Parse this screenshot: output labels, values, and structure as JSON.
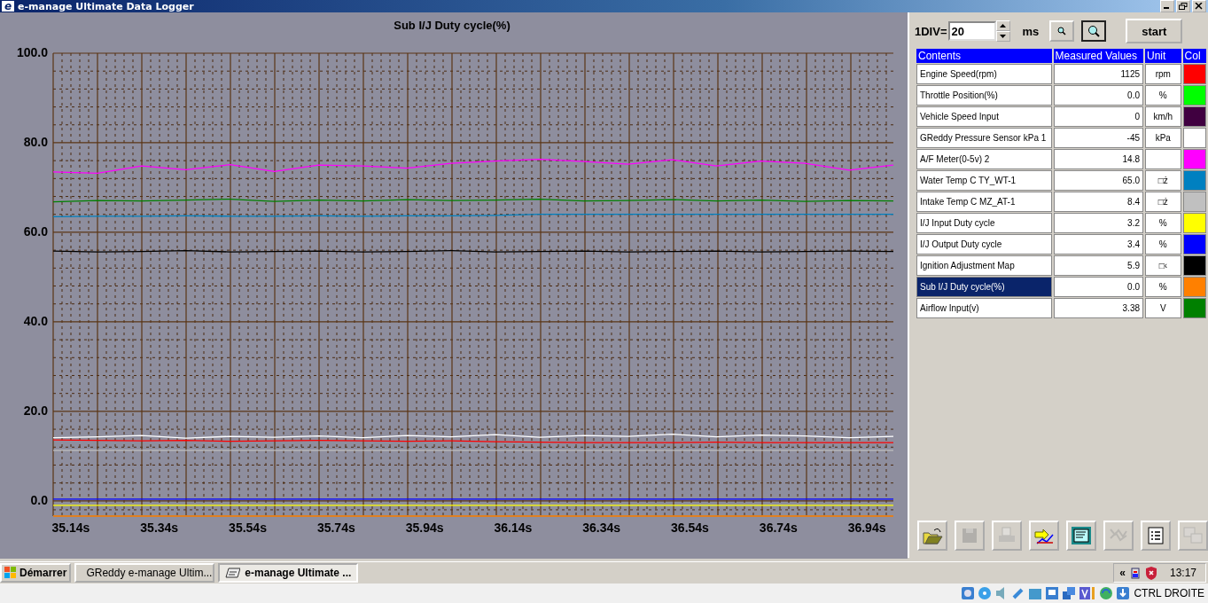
{
  "window": {
    "logo": "e",
    "title": "e-manage Ultimate Data Logger"
  },
  "graph": {
    "chart_data": {
      "type": "line",
      "title": "Sub I/J Duty cycle(%)",
      "grid": true,
      "x": [
        35.1,
        35.2,
        35.3,
        35.4,
        35.5,
        35.6,
        35.7,
        35.8,
        35.9,
        36.0,
        36.1,
        36.2,
        36.3,
        36.4,
        36.5,
        36.6,
        36.7,
        36.8,
        36.9,
        37.0
      ],
      "series": [
        {
          "color": "#ff00ff",
          "values": [
            73.5,
            73.2,
            74.8,
            74.0,
            75.1,
            73.6,
            75.0,
            74.8,
            74.3,
            75.4,
            75.9,
            76.3,
            75.8,
            75.2,
            76.2,
            74.8,
            75.9,
            75.4,
            73.9,
            75.0
          ]
        },
        {
          "color": "#008000",
          "values": [
            66.8,
            67.1,
            67.0,
            67.2,
            67.4,
            66.9,
            67.2,
            67.0,
            67.3,
            67.1,
            67.2,
            67.4,
            67.0,
            67.1,
            67.3,
            67.0,
            67.2,
            66.9,
            67.1,
            67.0
          ]
        },
        {
          "color": "#0080c0",
          "values": [
            63.5,
            63.6,
            63.6,
            63.7,
            63.6,
            63.6,
            63.7,
            63.6,
            63.7,
            63.7,
            63.8,
            64.0,
            64.0,
            64.0,
            64.0,
            64.0,
            64.0,
            64.0,
            64.0,
            64.0
          ]
        },
        {
          "color": "#000000",
          "values": [
            55.8,
            55.6,
            55.7,
            55.9,
            55.6,
            55.7,
            55.8,
            55.6,
            55.7,
            55.9,
            55.6,
            55.7,
            55.8,
            55.6,
            55.7,
            55.8,
            55.6,
            55.7,
            55.8,
            55.7
          ]
        },
        {
          "color": "#ffffff",
          "values": [
            14.1,
            14.3,
            14.6,
            14.0,
            14.4,
            14.2,
            14.5,
            14.1,
            14.6,
            14.3,
            14.8,
            14.2,
            14.6,
            14.4,
            14.9,
            14.3,
            14.7,
            14.5,
            14.1,
            14.4
          ]
        },
        {
          "color": "#ff0000",
          "values": [
            13.6,
            13.5,
            13.4,
            13.5,
            13.3,
            13.4,
            13.5,
            13.4,
            13.3,
            13.4,
            13.2,
            13.1,
            13.0,
            13.0,
            13.0,
            13.1,
            13.0,
            13.0,
            13.0,
            13.0
          ]
        },
        {
          "color": "#c0c0c0",
          "values": [
            11.3,
            11.3,
            11.3,
            11.3,
            11.3,
            11.3,
            11.3,
            11.3,
            11.3,
            11.3,
            11.3,
            11.3,
            11.3,
            11.3,
            11.3,
            11.3,
            11.3,
            11.3,
            11.3,
            11.3
          ]
        },
        {
          "color": "#ffff00",
          "values": [
            -1,
            -1,
            -1,
            -1,
            -1,
            -1,
            -1,
            -1,
            -1,
            -1,
            -1,
            -1,
            -1,
            -1,
            -1,
            -1,
            -1,
            -1,
            -1,
            -1
          ]
        },
        {
          "color": "#0000ff",
          "values": [
            0.4,
            0.4,
            0.4,
            0.4,
            0.4,
            0.4,
            0.4,
            0.4,
            0.4,
            0.4,
            0.4,
            0.4,
            0.4,
            0.4,
            0.4,
            0.4,
            0.4,
            0.4,
            0.4,
            0.4
          ]
        }
      ],
      "xlim": [
        35.1,
        37.0
      ],
      "ylim": [
        -3.4,
        100
      ],
      "xticks": [
        {
          "value": 35.14,
          "label": "35.14s"
        },
        {
          "value": 35.34,
          "label": "35.34s"
        },
        {
          "value": 35.54,
          "label": "35.54s"
        },
        {
          "value": 35.74,
          "label": "35.74s"
        },
        {
          "value": 35.94,
          "label": "35.94s"
        },
        {
          "value": 36.14,
          "label": "36.14s"
        },
        {
          "value": 36.34,
          "label": "36.34s"
        },
        {
          "value": 36.54,
          "label": "36.54s"
        },
        {
          "value": 36.74,
          "label": "36.74s"
        },
        {
          "value": 36.94,
          "label": "36.94s"
        }
      ],
      "yticks": [
        {
          "value": 0,
          "label": "0.0"
        },
        {
          "value": 20,
          "label": "20.0"
        },
        {
          "value": 40,
          "label": "40.0"
        },
        {
          "value": 60,
          "label": "60.0"
        },
        {
          "value": 80,
          "label": "80.0"
        },
        {
          "value": 100,
          "label": "100.0"
        }
      ]
    }
  },
  "controls": {
    "div_label": "1DIV=",
    "div_value": "20",
    "unit": "ms",
    "start_button": "start"
  },
  "table": {
    "columns": [
      "Contents",
      "Measured Values",
      "Unit",
      "Col"
    ],
    "rows": [
      {
        "contents": "Engine Speed(rpm)",
        "value": "1125",
        "unit": "rpm",
        "color": "#ff0000",
        "selected": false
      },
      {
        "contents": "Throttle Position(%)",
        "value": "0.0",
        "unit": "%",
        "color": "#00ff00",
        "selected": false
      },
      {
        "contents": "Vehicle Speed Input",
        "value": "0",
        "unit": "km/h",
        "color": "#400040",
        "selected": false
      },
      {
        "contents": "GReddy Pressure Sensor kPa 1",
        "value": "-45",
        "unit": "kPa",
        "color": "#ffffff",
        "selected": false
      },
      {
        "contents": "A/F Meter(0-5v) 2",
        "value": "14.8",
        "color": "#ff00ff",
        "selected": false
      },
      {
        "contents": "Water Temp C TY_WT-1",
        "value": "65.0",
        "unit": "□ż",
        "color": "#0080c0",
        "selected": false
      },
      {
        "contents": "Intake Temp C MZ_AT-1",
        "value": "8.4",
        "unit": "□ż",
        "color": "#c0c0c0",
        "selected": false
      },
      {
        "contents": "I/J Input Duty cycle",
        "value": "3.2",
        "unit": "%",
        "color": "#ffff00",
        "selected": false
      },
      {
        "contents": "I/J Output Duty cycle",
        "value": "3.4",
        "unit": "%",
        "color": "#0000ff",
        "selected": false
      },
      {
        "contents": "Ignition Adjustment Map",
        "value": "5.9",
        "unit": "□‹",
        "color": "#000000",
        "selected": false
      },
      {
        "contents": "Sub I/J Duty cycle(%)",
        "value": "0.0",
        "unit": "%",
        "color": "#ff8000",
        "selected": true
      },
      {
        "contents": "Airflow Input(v)",
        "value": "3.38",
        "unit": "V",
        "color": "#008000",
        "selected": false
      }
    ]
  },
  "toolbar": [
    {
      "kind": "open",
      "disabled": false
    },
    {
      "kind": "save",
      "disabled": true
    },
    {
      "kind": "print",
      "disabled": true
    },
    {
      "kind": "export",
      "disabled": false
    },
    {
      "kind": "text",
      "disabled": false
    },
    {
      "kind": "graph",
      "disabled": true
    },
    {
      "kind": "list",
      "disabled": false
    },
    {
      "kind": "windows",
      "disabled": true
    }
  ],
  "taskbar": {
    "start": "Démarrer",
    "tasks": [
      {
        "label": "GReddy e-manage Ultim...",
        "selected": false
      },
      {
        "label": "e-manage Ultimate ...",
        "selected": true
      }
    ],
    "tray_toggle": "«",
    "clock": "13:17"
  },
  "status_bar": {
    "label": "CTRL DROITE"
  }
}
